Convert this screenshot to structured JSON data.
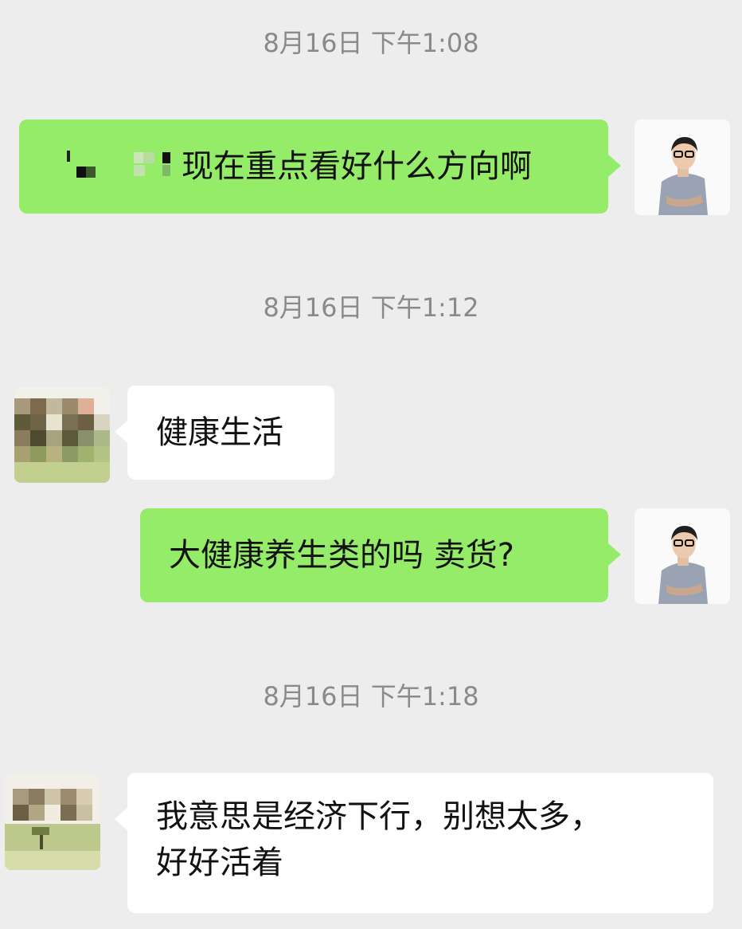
{
  "messages": [
    {
      "timestamp": "8月16日 下午1:08"
    },
    {
      "sender": "me",
      "text": "现在重点看好什么方向啊"
    },
    {
      "timestamp": "8月16日 下午1:12"
    },
    {
      "sender": "other",
      "text": "健康生活"
    },
    {
      "sender": "me",
      "text": "大健康养生类的吗 卖货?"
    },
    {
      "timestamp": "8月16日 下午1:18"
    },
    {
      "sender": "other",
      "text_line1": "我意思是经济下行，别想太多，",
      "text_line2": "好好活着"
    }
  ],
  "colors": {
    "background": "#ededed",
    "my_bubble": "#95ec69",
    "other_bubble": "#ffffff",
    "timestamp_text": "#8a8a8a"
  },
  "icons": {
    "my_avatar": "man-with-glasses-photo-avatar",
    "other_avatar": "pixelated-landscape-avatar"
  }
}
